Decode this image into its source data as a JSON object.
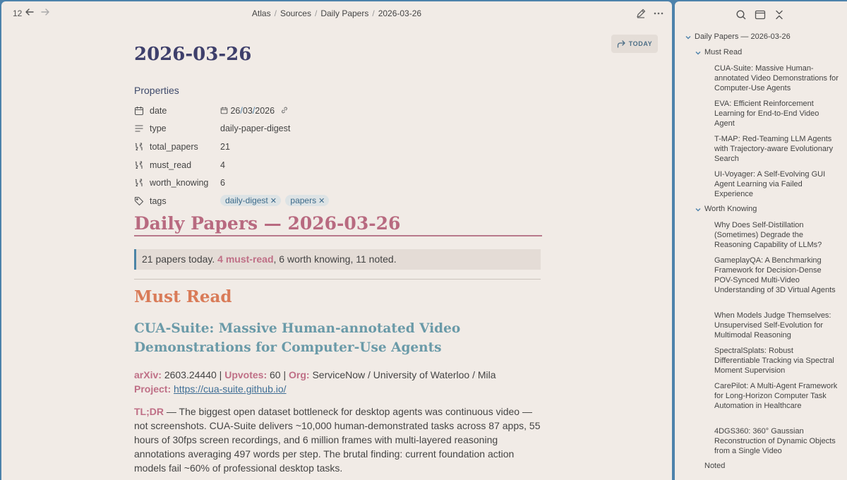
{
  "topbar": {
    "history_count": "12",
    "breadcrumb": [
      "Atlas",
      "Sources",
      "Daily Papers",
      "2026-03-26"
    ]
  },
  "today_button": {
    "label": "TODAY"
  },
  "note": {
    "title": "2026-03-26",
    "properties_heading": "Properties",
    "properties": [
      {
        "key": "date",
        "value": "26/03/2026",
        "icon": "calendar-icon"
      },
      {
        "key": "type",
        "value": "daily-paper-digest",
        "icon": "text-lines-icon"
      },
      {
        "key": "total_papers",
        "value": "21",
        "icon": "number-icon"
      },
      {
        "key": "must_read",
        "value": "4",
        "icon": "number-icon"
      },
      {
        "key": "worth_knowing",
        "value": "6",
        "icon": "number-icon"
      },
      {
        "key": "tags",
        "icon": "tags-icon"
      }
    ],
    "date_parts": {
      "d": "26",
      "m": "03",
      "y": "2026"
    },
    "tags": [
      "daily-digest",
      "papers"
    ],
    "heading": "Daily Papers — 2026-03-26",
    "callout": {
      "prefix": "21 papers today. ",
      "highlight": "4 must-read",
      "suffix": ", 6 worth knowing, 11 noted."
    },
    "section": "Must Read",
    "paper": {
      "title": "CUA-Suite: Massive Human-annotated Video Demonstrations for Computer-Use Agents",
      "arxiv_label": "arXiv:",
      "arxiv": "2603.24440",
      "upvotes_label": "Upvotes:",
      "upvotes": "60",
      "org_label": "Org:",
      "org": "ServiceNow / University of Waterloo / Mila",
      "project_label": "Project:",
      "project_url": "https://cua-suite.github.io/",
      "tldr_label": "TL;DR",
      "tldr": " — The biggest open dataset bottleneck for desktop agents was continuous video — not screenshots. CUA-Suite delivers ~10,000 human-demonstrated tasks across 87 apps, 55 hours of 30fps screen recordings, and 6 million frames with multi-layered reasoning annotations averaging 497 words per step. The brutal finding: current foundation action models fail ~60% of professional desktop tasks."
    }
  },
  "outline": {
    "root": "Daily Papers — 2026-03-26",
    "must_read": "Must Read",
    "must_read_items": [
      "CUA-Suite: Massive Human-annotated Video Demonstrations for Computer-Use Agents",
      "EVA: Efficient Reinforcement Learning for End-to-End Video Agent",
      "T-MAP: Red-Teaming LLM Agents with Trajectory-aware Evolutionary Search",
      "UI-Voyager: A Self-Evolving GUI Agent Learning via Failed Experience"
    ],
    "worth_knowing": "Worth Knowing",
    "worth_knowing_items": [
      "Why Does Self-Distillation (Sometimes) Degrade the Reasoning Capability of LLMs?",
      "GameplayQA: A Benchmarking Framework for Decision-Dense POV-Synced Multi-Video Understanding of 3D Virtual Agents",
      "When Models Judge Themselves: Unsupervised Self-Evolution for Multimodal Reasoning",
      "SpectralSplats: Robust Differentiable Tracking via Spectral Moment Supervision",
      "CarePilot: A Multi-Agent Framework for Long-Horizon Computer Task Automation in Healthcare",
      "4DGS360: 360° Gaussian Reconstruction of Dynamic Objects from a Single Video"
    ],
    "noted": "Noted"
  }
}
